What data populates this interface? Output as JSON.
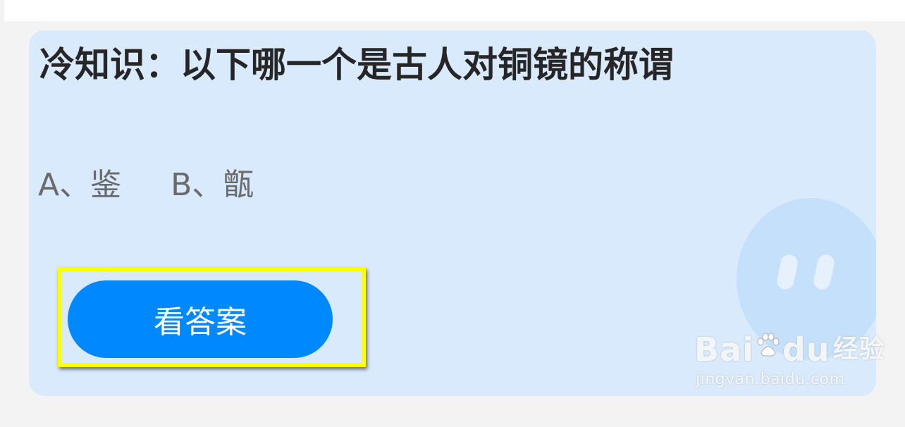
{
  "card": {
    "question": "冷知识：以下哪一个是古人对铜镜的称谓",
    "options": [
      "A、鉴",
      "B、甑"
    ],
    "answer_button_label": "看答案"
  },
  "watermark": {
    "logo_text_1": "Bai",
    "logo_text_2": "du",
    "logo_text_3": "经验",
    "url": "jingyan.baidu.com"
  },
  "colors": {
    "card_background": "#d9eafc",
    "button_blue": "#0088ff",
    "highlight_yellow": "#ffff00",
    "page_background": "#f3f3f3"
  }
}
